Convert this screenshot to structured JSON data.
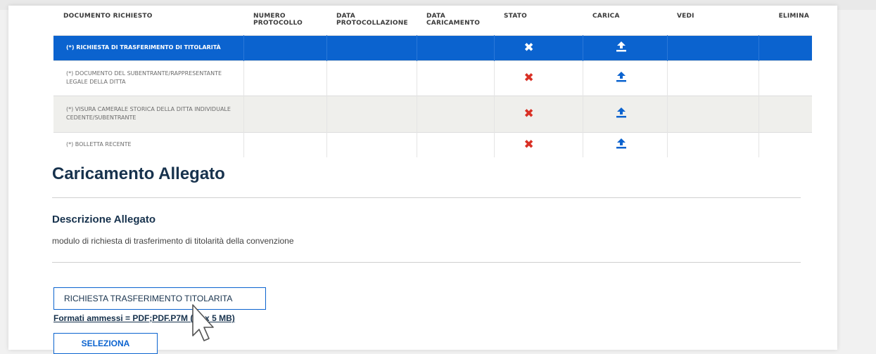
{
  "table": {
    "headers": {
      "documento": "DOCUMENTO RICHIESTO",
      "protocollo": "NUMERO PROTOCOLLO",
      "data_protocollazione": "DATA PROTOCOLLAZIONE",
      "data_caricamento": "DATA CARICAMENTO",
      "stato": "STATO",
      "carica": "CARICA",
      "vedi": "VEDI",
      "elimina": "ELIMINA"
    },
    "rows": [
      {
        "documento": "(*) RICHIESTA DI TRASFERIMENTO DI TITOLARITÀ",
        "stato_icon": "x-icon",
        "carica_icon": "upload-icon",
        "selected": true
      },
      {
        "documento": "(*) DOCUMENTO DEL SUBENTRANTE/RAPPRESENTANTE LEGALE DELLA DITTA",
        "stato_icon": "x-icon",
        "carica_icon": "upload-icon",
        "selected": false
      },
      {
        "documento": "(*) VISURA CAMERALE STORICA DELLA DITTA INDIVIDUALE CEDENTE/SUBENTRANTE",
        "stato_icon": "x-icon",
        "carica_icon": "upload-icon",
        "selected": false
      },
      {
        "documento": "(*) BOLLETTA RECENTE",
        "stato_icon": "x-icon",
        "carica_icon": "upload-icon",
        "selected": false
      }
    ]
  },
  "upload_section": {
    "title": "Caricamento Allegato",
    "description_label": "Descrizione Allegato",
    "description_text": "modulo di richiesta di trasferimento di titolarità della convenzione",
    "document_button_label": "RICHIESTA TRASFERIMENTO TITOLARITA",
    "formats_text": "Formati ammessi = PDF;PDF.P7M (Max 5 MB)",
    "select_button_label": "SELEZIONA"
  },
  "colors": {
    "accent": "#0b63cf",
    "error": "#d93025",
    "heading": "#17324d"
  }
}
